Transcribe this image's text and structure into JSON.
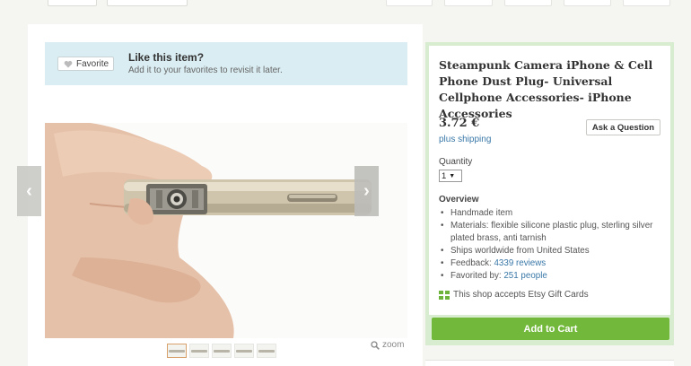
{
  "colors": {
    "accent": "#72b83a",
    "link": "#3a78a8",
    "banner": "#daedf2"
  },
  "favorite": {
    "button_label": "Favorite",
    "title": "Like this item?",
    "subtitle": "Add it to your favorites to revisit it later."
  },
  "gallery": {
    "thumb_count": 5,
    "zoom_label": "zoom"
  },
  "listing": {
    "title": "Steampunk Camera iPhone & Cell Phone Dust Plug- Universal Cellphone Accessories- iPhone Accessories",
    "price": "3.72 €",
    "shipping": "plus shipping",
    "ask_label": "Ask a Question",
    "quantity_label": "Quantity",
    "quantity_value": "1",
    "overview_heading": "Overview",
    "overview": {
      "item1": "Handmade item",
      "item2": "Materials: flexible silicone plastic plug, sterling silver plated brass, anti tarnish",
      "item3": "Ships worldwide from United States",
      "feedback_prefix": "Feedback: ",
      "feedback_link": "4339 reviews",
      "favorited_prefix": "Favorited by: ",
      "favorited_link": "251 people"
    },
    "gift_text": "This shop accepts Etsy Gift Cards",
    "cart_label": "Add to Cart"
  }
}
